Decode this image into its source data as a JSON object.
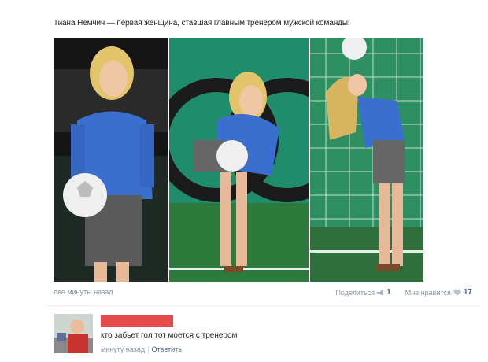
{
  "post": {
    "text": "Тиана Немчич — первая женщина, ставшая главным тренером мужской команды!",
    "time": "две минуты назад",
    "share_label": "Поделиться",
    "share_count": "1",
    "like_label": "Мне нравится",
    "like_count": "17"
  },
  "icons": {
    "share": "megaphone-icon",
    "like": "heart-icon"
  },
  "comment": {
    "author_redacted": true,
    "text": "кто забьет гол тот моется с тренером",
    "time": "минуту назад",
    "separator": "|",
    "reply_label": "Ответить"
  },
  "colors": {
    "link": "#45688e",
    "meta": "#8a96a3",
    "redaction": "#e54b4b",
    "blouse": "#3a6fd0",
    "field": "#2d8a5e"
  }
}
